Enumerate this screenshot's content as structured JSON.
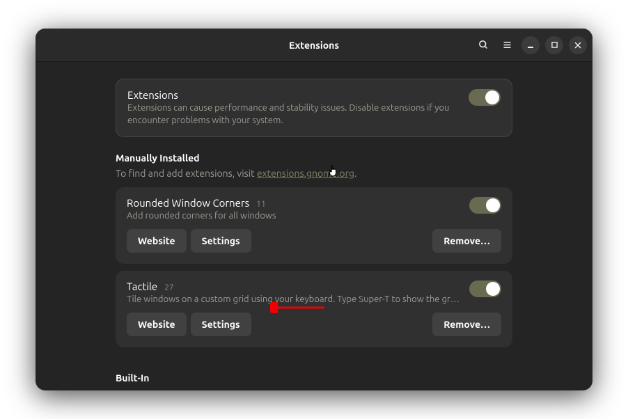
{
  "window": {
    "title": "Extensions"
  },
  "global": {
    "title": "Extensions",
    "desc": "Extensions can cause performance and stability issues. Disable extensions if you encounter problems with your system."
  },
  "manual": {
    "heading": "Manually Installed",
    "sub_prefix": "To find and add extensions, visit ",
    "link_text": "extensions.gnome.org",
    "sub_suffix": "."
  },
  "ext": [
    {
      "name": "Rounded Window Corners",
      "version": "11",
      "desc": "Add rounded corners for all windows",
      "website": "Website",
      "settings": "Settings",
      "remove": "Remove…"
    },
    {
      "name": "Tactile",
      "version": "27",
      "desc": "Tile windows on a custom grid using your keyboard. Type Super-T to show the grid, the…",
      "website": "Website",
      "settings": "Settings",
      "remove": "Remove…"
    }
  ],
  "builtin": {
    "heading": "Built-In"
  }
}
